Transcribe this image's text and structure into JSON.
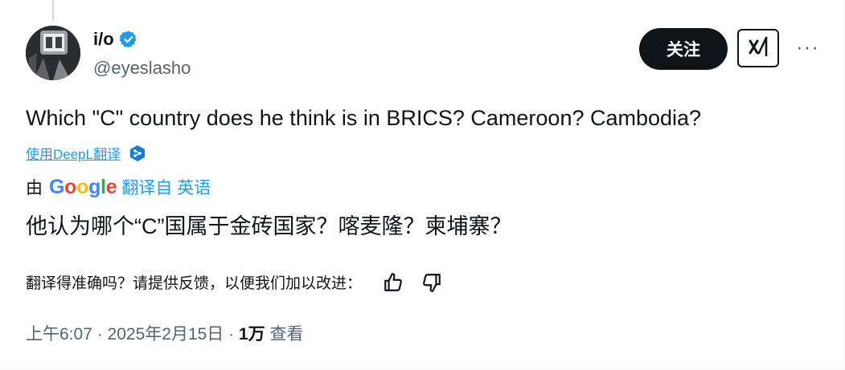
{
  "author": {
    "display_name": "i/o",
    "handle": "@eyeslasho"
  },
  "actions": {
    "follow_label": "关注",
    "more_label": "···"
  },
  "tweet": {
    "text": "Which \"C\" country does he think is in BRICS? Cameroon? Cambodia?"
  },
  "translation": {
    "deepl_link": "使用DeepL翻译",
    "by_prefix": "由",
    "provider": [
      "G",
      "o",
      "o",
      "g",
      "l",
      "e"
    ],
    "from_label": "翻译自 英语",
    "translated_text": "他认为哪个“C”国属于金砖国家？喀麦隆？柬埔寨？",
    "feedback_prompt": "翻译得准确吗？请提供反馈，以便我们加以改进："
  },
  "meta": {
    "time": "上午6:07",
    "separator": " · ",
    "date": "2025年2月15日",
    "views_count": "1万",
    "views_label": " 查看"
  },
  "colors": {
    "text": "#0f1419",
    "secondary": "#536471",
    "link": "#1d9bf0",
    "follow_bg": "#0f1419"
  }
}
